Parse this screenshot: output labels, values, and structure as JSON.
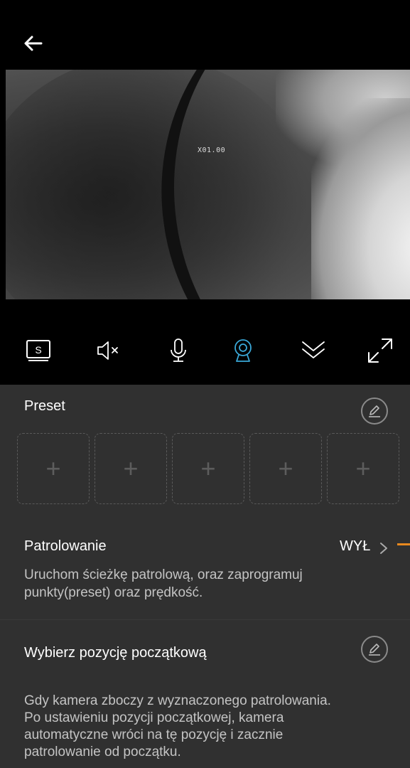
{
  "header": {
    "back_icon": "arrow-left-icon"
  },
  "video": {
    "osd_text": "X01.00"
  },
  "toolbar": {
    "items": [
      {
        "icon": "screenshot-s-icon"
      },
      {
        "icon": "speaker-muted-icon"
      },
      {
        "icon": "microphone-icon"
      },
      {
        "icon": "ptz-camera-icon",
        "active_color": "#3aa8d8"
      },
      {
        "icon": "chevron-double-down-icon"
      },
      {
        "icon": "fullscreen-expand-icon"
      }
    ]
  },
  "preset": {
    "title": "Preset",
    "slots": [
      "+",
      "+",
      "+",
      "+",
      "+"
    ]
  },
  "patrol": {
    "title": "Patrolowanie",
    "status": "WYŁ",
    "description_line1": "Uruchom ścieżkę patrolową, oraz zaprogramuj",
    "description_line2": "punkty(preset) oraz prędkość."
  },
  "home_position": {
    "title": "Wybierz pozycję początkową",
    "description_line1": "Gdy kamera zboczy z wyznaczonego patrolowania.",
    "description_line2": "Po ustawieniu pozycji początkowej, kamera",
    "description_line3": "automatyczne wróci na tę pozycję i zacznie",
    "description_line4": "patrolowanie od początku."
  },
  "colors": {
    "accent_orange": "#e8891f",
    "panel_bg": "#303030",
    "active_blue": "#3aa8d8"
  }
}
